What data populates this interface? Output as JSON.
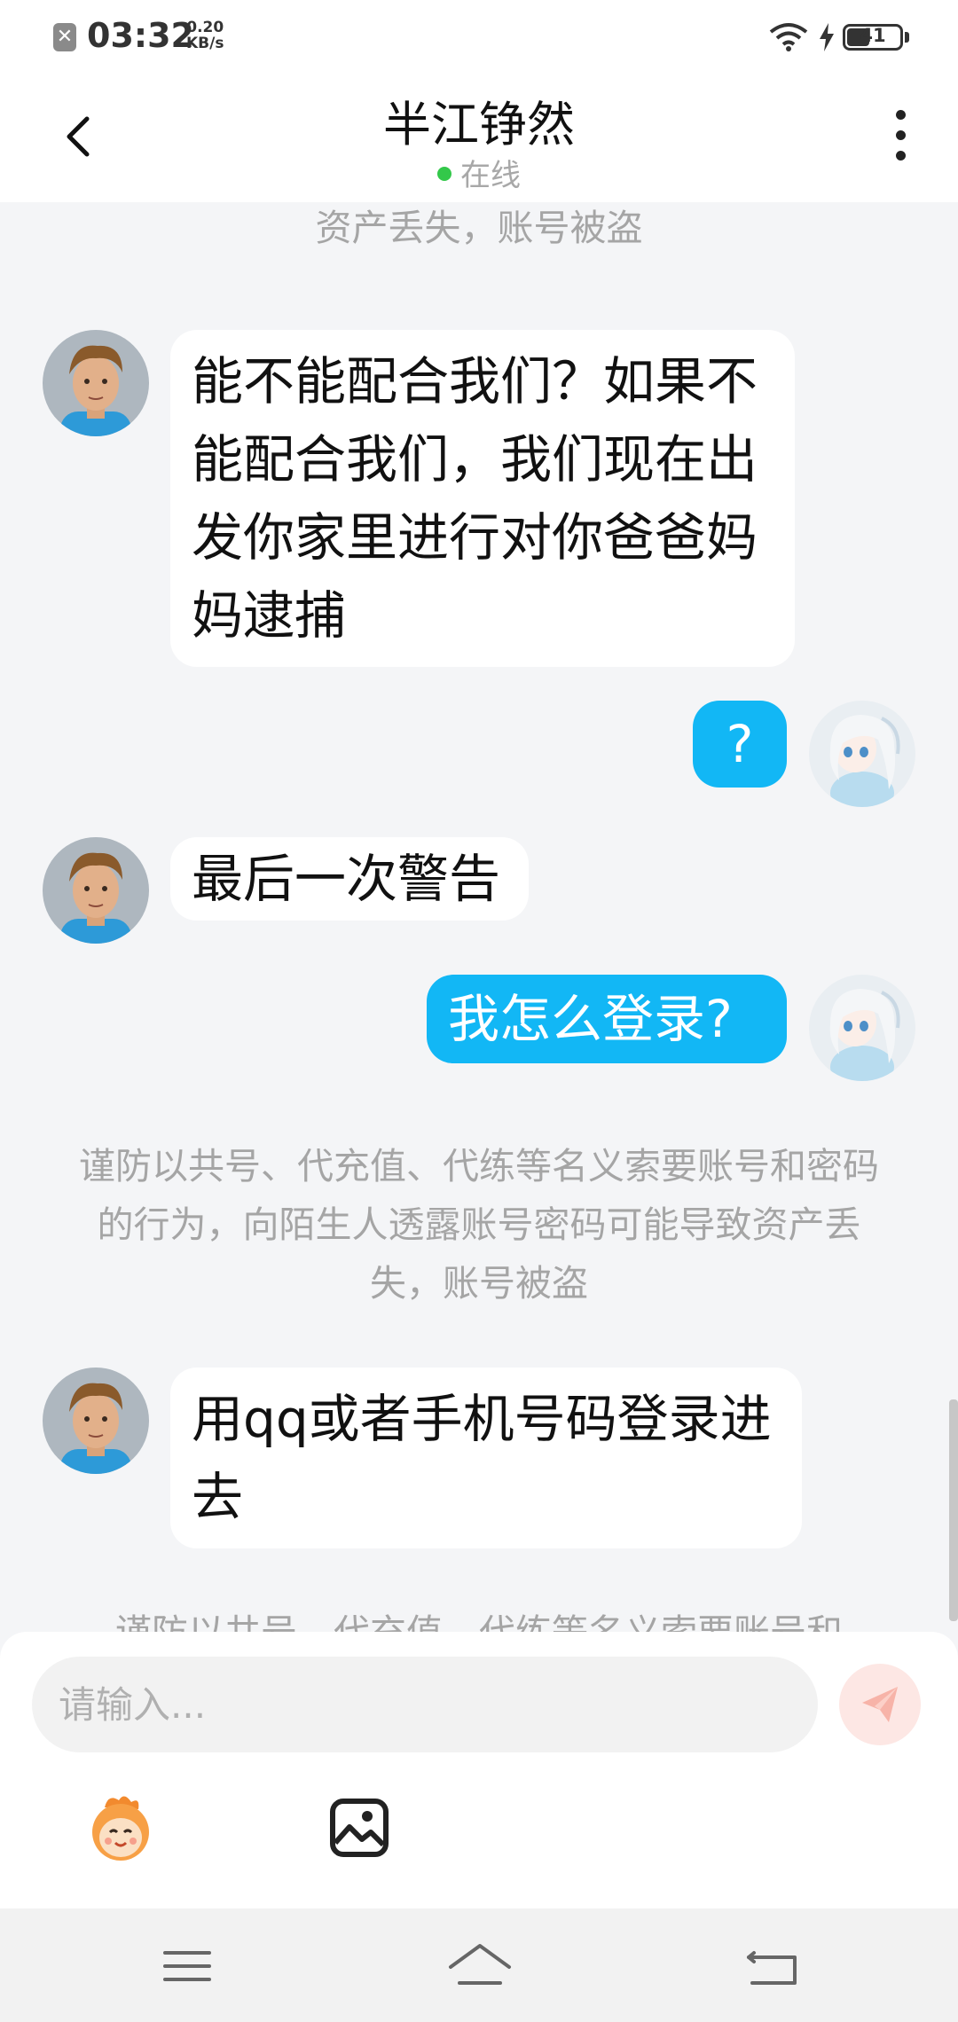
{
  "status_bar": {
    "time": "03:32",
    "speed_value": "0.20",
    "speed_unit": "KB/s",
    "battery": "41",
    "notification_icon": "close-notification-icon"
  },
  "header": {
    "title": "半江铮然",
    "status": "在线"
  },
  "chat": {
    "top_notice_partial": "资产丢失，账号被盗",
    "messages": [
      {
        "sender": "contact",
        "text": "能不能配合我们？如果不能配合我们，我们现在出发你家里进行对你爸爸妈妈逮捕"
      },
      {
        "sender": "me",
        "text": "?"
      },
      {
        "sender": "contact",
        "text": "最后一次警告"
      },
      {
        "sender": "me",
        "text": "我怎么登录?"
      },
      {
        "sender": "system",
        "text": "谨防以共号、代充值、代练等名义索要账号和密码的行为，向陌生人透露账号密码可能导致资产丢失，账号被盗"
      },
      {
        "sender": "contact",
        "text": "用qq或者手机号码登录进去"
      }
    ],
    "bottom_notice_partial": "谨防以共号、代充值、代练等名义索要账号和"
  },
  "input": {
    "placeholder": "请输入..."
  },
  "colors": {
    "accent_blue": "#12b7f5",
    "online_green": "#33c84a",
    "send_disabled": "#fde7e4"
  }
}
